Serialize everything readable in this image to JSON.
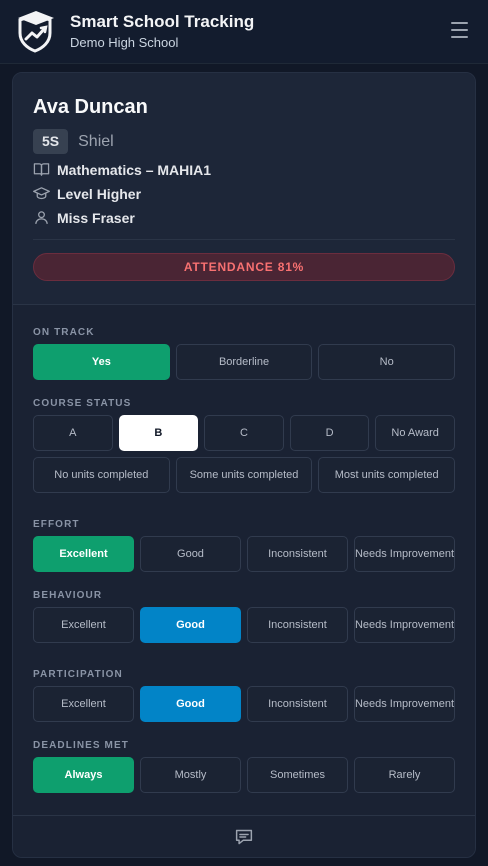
{
  "app": {
    "title": "Smart School Tracking",
    "school": "Demo High School"
  },
  "student": {
    "name": "Ava Duncan",
    "class_code": "5S",
    "class_group": "Shiel",
    "subject": "Mathematics – MAHIA1",
    "level": "Level Higher",
    "teacher": "Miss Fraser",
    "attendance_label": "ATTENDANCE 81%",
    "attendance_percent": 81
  },
  "on_track": {
    "label": "ON TRACK",
    "options": [
      "Yes",
      "Borderline",
      "No"
    ],
    "selected": "Yes"
  },
  "course_status": {
    "label": "COURSE STATUS",
    "grades": [
      "A",
      "B",
      "C",
      "D",
      "No Award"
    ],
    "selected_grade": "B",
    "units": [
      "No units completed",
      "Some units completed",
      "Most units completed"
    ]
  },
  "effort": {
    "label": "EFFORT",
    "options": [
      "Excellent",
      "Good",
      "Inconsistent",
      "Needs Improvement"
    ],
    "selected": "Excellent"
  },
  "behaviour": {
    "label": "BEHAVIOUR",
    "options": [
      "Excellent",
      "Good",
      "Inconsistent",
      "Needs Improvement"
    ],
    "selected": "Good"
  },
  "participation": {
    "label": "PARTICIPATION",
    "options": [
      "Excellent",
      "Good",
      "Inconsistent",
      "Needs Improvement"
    ],
    "selected": "Good"
  },
  "deadlines": {
    "label": "DEADLINES MET",
    "options": [
      "Always",
      "Mostly",
      "Sometimes",
      "Rarely"
    ],
    "selected": "Always"
  },
  "icons": {
    "logo": "shield-graduation-logo",
    "menu": "hamburger-menu-icon",
    "subject": "book-open-icon",
    "level": "graduation-cap-icon",
    "teacher": "user-icon",
    "comment": "comment-icon"
  },
  "colors": {
    "background": "#111827",
    "card": "#1a2233",
    "selected_green": "#0e9f6e",
    "selected_blue": "#0284c7",
    "attendance_text": "#f87171",
    "attendance_bg": "#4a2534"
  }
}
